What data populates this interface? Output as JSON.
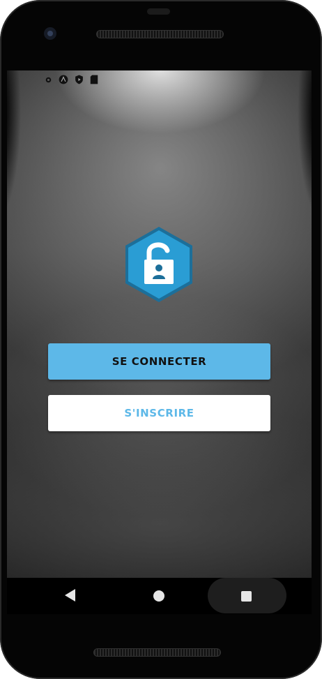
{
  "status_bar": {
    "icons": [
      "settings-icon",
      "assistant-icon",
      "shield-play-icon",
      "sd-card-icon"
    ]
  },
  "logo": {
    "name": "lock-badge-icon",
    "colors": {
      "hexagon": "#2a9dd4",
      "hexagon_border": "#1c6f9a",
      "lock": "#ffffff",
      "keyhole_person": "#1c6f9a"
    }
  },
  "actions": {
    "login_label": "SE CONNECTER",
    "signup_label": "S'INSCRIRE"
  },
  "navigation": {
    "items": [
      "back-icon",
      "home-icon",
      "recents-icon"
    ]
  },
  "theme": {
    "accent": "#5db8e8",
    "button_text_dark": "#111111",
    "button_light_bg": "#ffffff"
  }
}
